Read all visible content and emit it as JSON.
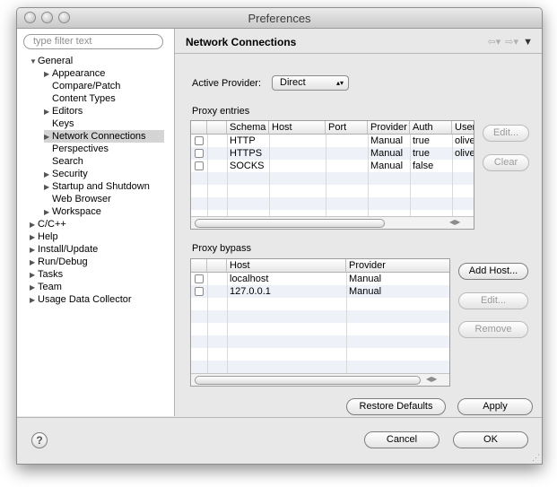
{
  "window": {
    "title": "Preferences"
  },
  "sidebar": {
    "filter_placeholder": "type filter text",
    "items": [
      {
        "label": "General",
        "arrow": "▼"
      },
      {
        "label": "Appearance",
        "arrow": "▶"
      },
      {
        "label": "Compare/Patch",
        "arrow": ""
      },
      {
        "label": "Content Types",
        "arrow": ""
      },
      {
        "label": "Editors",
        "arrow": "▶"
      },
      {
        "label": "Keys",
        "arrow": ""
      },
      {
        "label": "Network Connections",
        "arrow": "▶"
      },
      {
        "label": "Perspectives",
        "arrow": ""
      },
      {
        "label": "Search",
        "arrow": ""
      },
      {
        "label": "Security",
        "arrow": "▶"
      },
      {
        "label": "Startup and Shutdown",
        "arrow": "▶"
      },
      {
        "label": "Web Browser",
        "arrow": ""
      },
      {
        "label": "Workspace",
        "arrow": "▶"
      },
      {
        "label": "C/C++",
        "arrow": "▶"
      },
      {
        "label": "Help",
        "arrow": "▶"
      },
      {
        "label": "Install/Update",
        "arrow": "▶"
      },
      {
        "label": "Run/Debug",
        "arrow": "▶"
      },
      {
        "label": "Tasks",
        "arrow": "▶"
      },
      {
        "label": "Team",
        "arrow": "▶"
      },
      {
        "label": "Usage Data Collector",
        "arrow": "▶"
      }
    ],
    "selected": "Network Connections"
  },
  "header": {
    "title": "Network Connections"
  },
  "provider": {
    "label": "Active Provider:",
    "value": "Direct"
  },
  "proxy_entries": {
    "label": "Proxy entries",
    "columns": [
      "",
      "Schema",
      "Host",
      "Port",
      "Provider",
      "Auth",
      "User"
    ],
    "rows": [
      {
        "schema": "HTTP",
        "host": "",
        "port": "",
        "provider": "Manual",
        "auth": "true",
        "user": "olive"
      },
      {
        "schema": "HTTPS",
        "host": "",
        "port": "",
        "provider": "Manual",
        "auth": "true",
        "user": "olive"
      },
      {
        "schema": "SOCKS",
        "host": "",
        "port": "",
        "provider": "Manual",
        "auth": "false",
        "user": ""
      }
    ],
    "edit_label": "Edit...",
    "clear_label": "Clear"
  },
  "proxy_bypass": {
    "label": "Proxy bypass",
    "columns": [
      "",
      "Host",
      "Provider"
    ],
    "rows": [
      {
        "host": "localhost",
        "provider": "Manual"
      },
      {
        "host": "127.0.0.1",
        "provider": "Manual"
      }
    ],
    "add_label": "Add Host...",
    "edit_label": "Edit...",
    "remove_label": "Remove"
  },
  "actions": {
    "restore_label": "Restore Defaults",
    "apply_label": "Apply"
  },
  "footer": {
    "help_glyph": "?",
    "cancel_label": "Cancel",
    "ok_label": "OK"
  }
}
